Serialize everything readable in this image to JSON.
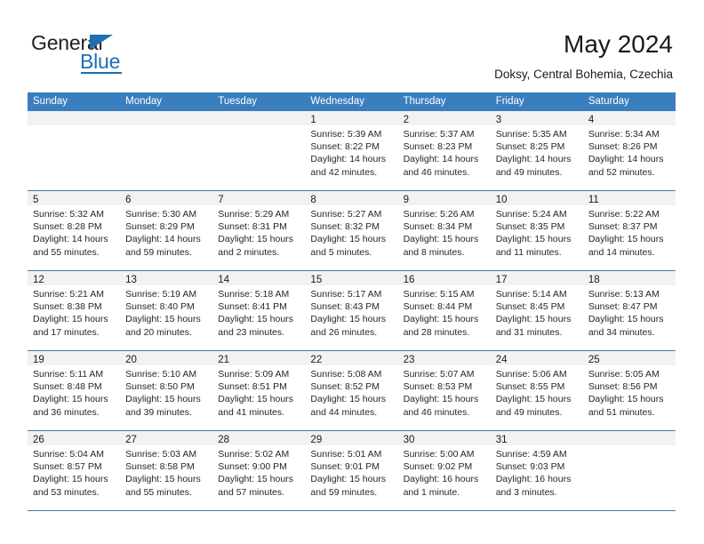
{
  "brand": {
    "name_top": "General",
    "name_bottom": "Blue",
    "accent_color": "#1f6fb4"
  },
  "header": {
    "title": "May 2024",
    "subtitle": "Doksy, Central Bohemia, Czechia"
  },
  "theme": {
    "header_row_bg": "#3a7ebe",
    "day_band_bg": "#f2f2f2",
    "grid_line": "#3a7ebe",
    "text": "#262626"
  },
  "weekdays": [
    "Sunday",
    "Monday",
    "Tuesday",
    "Wednesday",
    "Thursday",
    "Friday",
    "Saturday"
  ],
  "weeks": [
    [
      {
        "day": "",
        "empty": true,
        "sunrise": "",
        "sunset": "",
        "daylight1": "",
        "daylight2": ""
      },
      {
        "day": "",
        "empty": true,
        "sunrise": "",
        "sunset": "",
        "daylight1": "",
        "daylight2": ""
      },
      {
        "day": "",
        "empty": true,
        "sunrise": "",
        "sunset": "",
        "daylight1": "",
        "daylight2": ""
      },
      {
        "day": "1",
        "empty": false,
        "sunrise": "Sunrise: 5:39 AM",
        "sunset": "Sunset: 8:22 PM",
        "daylight1": "Daylight: 14 hours",
        "daylight2": "and 42 minutes."
      },
      {
        "day": "2",
        "empty": false,
        "sunrise": "Sunrise: 5:37 AM",
        "sunset": "Sunset: 8:23 PM",
        "daylight1": "Daylight: 14 hours",
        "daylight2": "and 46 minutes."
      },
      {
        "day": "3",
        "empty": false,
        "sunrise": "Sunrise: 5:35 AM",
        "sunset": "Sunset: 8:25 PM",
        "daylight1": "Daylight: 14 hours",
        "daylight2": "and 49 minutes."
      },
      {
        "day": "4",
        "empty": false,
        "sunrise": "Sunrise: 5:34 AM",
        "sunset": "Sunset: 8:26 PM",
        "daylight1": "Daylight: 14 hours",
        "daylight2": "and 52 minutes."
      }
    ],
    [
      {
        "day": "5",
        "empty": false,
        "sunrise": "Sunrise: 5:32 AM",
        "sunset": "Sunset: 8:28 PM",
        "daylight1": "Daylight: 14 hours",
        "daylight2": "and 55 minutes."
      },
      {
        "day": "6",
        "empty": false,
        "sunrise": "Sunrise: 5:30 AM",
        "sunset": "Sunset: 8:29 PM",
        "daylight1": "Daylight: 14 hours",
        "daylight2": "and 59 minutes."
      },
      {
        "day": "7",
        "empty": false,
        "sunrise": "Sunrise: 5:29 AM",
        "sunset": "Sunset: 8:31 PM",
        "daylight1": "Daylight: 15 hours",
        "daylight2": "and 2 minutes."
      },
      {
        "day": "8",
        "empty": false,
        "sunrise": "Sunrise: 5:27 AM",
        "sunset": "Sunset: 8:32 PM",
        "daylight1": "Daylight: 15 hours",
        "daylight2": "and 5 minutes."
      },
      {
        "day": "9",
        "empty": false,
        "sunrise": "Sunrise: 5:26 AM",
        "sunset": "Sunset: 8:34 PM",
        "daylight1": "Daylight: 15 hours",
        "daylight2": "and 8 minutes."
      },
      {
        "day": "10",
        "empty": false,
        "sunrise": "Sunrise: 5:24 AM",
        "sunset": "Sunset: 8:35 PM",
        "daylight1": "Daylight: 15 hours",
        "daylight2": "and 11 minutes."
      },
      {
        "day": "11",
        "empty": false,
        "sunrise": "Sunrise: 5:22 AM",
        "sunset": "Sunset: 8:37 PM",
        "daylight1": "Daylight: 15 hours",
        "daylight2": "and 14 minutes."
      }
    ],
    [
      {
        "day": "12",
        "empty": false,
        "sunrise": "Sunrise: 5:21 AM",
        "sunset": "Sunset: 8:38 PM",
        "daylight1": "Daylight: 15 hours",
        "daylight2": "and 17 minutes."
      },
      {
        "day": "13",
        "empty": false,
        "sunrise": "Sunrise: 5:19 AM",
        "sunset": "Sunset: 8:40 PM",
        "daylight1": "Daylight: 15 hours",
        "daylight2": "and 20 minutes."
      },
      {
        "day": "14",
        "empty": false,
        "sunrise": "Sunrise: 5:18 AM",
        "sunset": "Sunset: 8:41 PM",
        "daylight1": "Daylight: 15 hours",
        "daylight2": "and 23 minutes."
      },
      {
        "day": "15",
        "empty": false,
        "sunrise": "Sunrise: 5:17 AM",
        "sunset": "Sunset: 8:43 PM",
        "daylight1": "Daylight: 15 hours",
        "daylight2": "and 26 minutes."
      },
      {
        "day": "16",
        "empty": false,
        "sunrise": "Sunrise: 5:15 AM",
        "sunset": "Sunset: 8:44 PM",
        "daylight1": "Daylight: 15 hours",
        "daylight2": "and 28 minutes."
      },
      {
        "day": "17",
        "empty": false,
        "sunrise": "Sunrise: 5:14 AM",
        "sunset": "Sunset: 8:45 PM",
        "daylight1": "Daylight: 15 hours",
        "daylight2": "and 31 minutes."
      },
      {
        "day": "18",
        "empty": false,
        "sunrise": "Sunrise: 5:13 AM",
        "sunset": "Sunset: 8:47 PM",
        "daylight1": "Daylight: 15 hours",
        "daylight2": "and 34 minutes."
      }
    ],
    [
      {
        "day": "19",
        "empty": false,
        "sunrise": "Sunrise: 5:11 AM",
        "sunset": "Sunset: 8:48 PM",
        "daylight1": "Daylight: 15 hours",
        "daylight2": "and 36 minutes."
      },
      {
        "day": "20",
        "empty": false,
        "sunrise": "Sunrise: 5:10 AM",
        "sunset": "Sunset: 8:50 PM",
        "daylight1": "Daylight: 15 hours",
        "daylight2": "and 39 minutes."
      },
      {
        "day": "21",
        "empty": false,
        "sunrise": "Sunrise: 5:09 AM",
        "sunset": "Sunset: 8:51 PM",
        "daylight1": "Daylight: 15 hours",
        "daylight2": "and 41 minutes."
      },
      {
        "day": "22",
        "empty": false,
        "sunrise": "Sunrise: 5:08 AM",
        "sunset": "Sunset: 8:52 PM",
        "daylight1": "Daylight: 15 hours",
        "daylight2": "and 44 minutes."
      },
      {
        "day": "23",
        "empty": false,
        "sunrise": "Sunrise: 5:07 AM",
        "sunset": "Sunset: 8:53 PM",
        "daylight1": "Daylight: 15 hours",
        "daylight2": "and 46 minutes."
      },
      {
        "day": "24",
        "empty": false,
        "sunrise": "Sunrise: 5:06 AM",
        "sunset": "Sunset: 8:55 PM",
        "daylight1": "Daylight: 15 hours",
        "daylight2": "and 49 minutes."
      },
      {
        "day": "25",
        "empty": false,
        "sunrise": "Sunrise: 5:05 AM",
        "sunset": "Sunset: 8:56 PM",
        "daylight1": "Daylight: 15 hours",
        "daylight2": "and 51 minutes."
      }
    ],
    [
      {
        "day": "26",
        "empty": false,
        "sunrise": "Sunrise: 5:04 AM",
        "sunset": "Sunset: 8:57 PM",
        "daylight1": "Daylight: 15 hours",
        "daylight2": "and 53 minutes."
      },
      {
        "day": "27",
        "empty": false,
        "sunrise": "Sunrise: 5:03 AM",
        "sunset": "Sunset: 8:58 PM",
        "daylight1": "Daylight: 15 hours",
        "daylight2": "and 55 minutes."
      },
      {
        "day": "28",
        "empty": false,
        "sunrise": "Sunrise: 5:02 AM",
        "sunset": "Sunset: 9:00 PM",
        "daylight1": "Daylight: 15 hours",
        "daylight2": "and 57 minutes."
      },
      {
        "day": "29",
        "empty": false,
        "sunrise": "Sunrise: 5:01 AM",
        "sunset": "Sunset: 9:01 PM",
        "daylight1": "Daylight: 15 hours",
        "daylight2": "and 59 minutes."
      },
      {
        "day": "30",
        "empty": false,
        "sunrise": "Sunrise: 5:00 AM",
        "sunset": "Sunset: 9:02 PM",
        "daylight1": "Daylight: 16 hours",
        "daylight2": "and 1 minute."
      },
      {
        "day": "31",
        "empty": false,
        "sunrise": "Sunrise: 4:59 AM",
        "sunset": "Sunset: 9:03 PM",
        "daylight1": "Daylight: 16 hours",
        "daylight2": "and 3 minutes."
      },
      {
        "day": "",
        "empty": true,
        "sunrise": "",
        "sunset": "",
        "daylight1": "",
        "daylight2": ""
      }
    ]
  ]
}
